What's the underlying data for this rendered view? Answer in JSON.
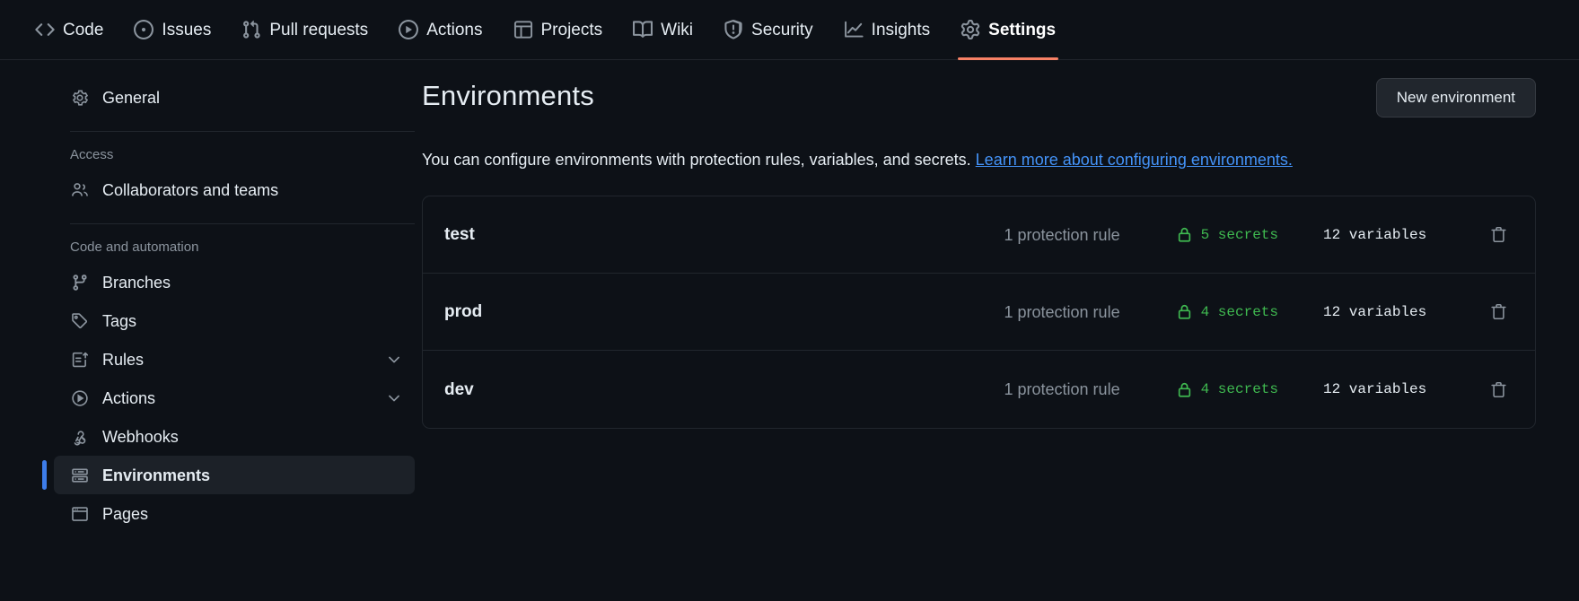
{
  "repo_nav": {
    "items": [
      {
        "label": "Code",
        "icon": "code-icon",
        "active": false
      },
      {
        "label": "Issues",
        "icon": "issue-icon",
        "active": false
      },
      {
        "label": "Pull requests",
        "icon": "git-pull-request-icon",
        "active": false
      },
      {
        "label": "Actions",
        "icon": "play-icon",
        "active": false
      },
      {
        "label": "Projects",
        "icon": "table-icon",
        "active": false
      },
      {
        "label": "Wiki",
        "icon": "book-icon",
        "active": false
      },
      {
        "label": "Security",
        "icon": "shield-icon",
        "active": false
      },
      {
        "label": "Insights",
        "icon": "graph-icon",
        "active": false
      },
      {
        "label": "Settings",
        "icon": "gear-icon",
        "active": true
      }
    ],
    "active_underline_color": "#f78166"
  },
  "sidebar": {
    "groups": [
      {
        "title": null,
        "items": [
          {
            "label": "General",
            "icon": "gear-icon",
            "chevron": false,
            "selected": false
          }
        ]
      },
      {
        "title": "Access",
        "items": [
          {
            "label": "Collaborators and teams",
            "icon": "people-icon",
            "chevron": false,
            "selected": false
          }
        ]
      },
      {
        "title": "Code and automation",
        "items": [
          {
            "label": "Branches",
            "icon": "git-branch-icon",
            "chevron": false,
            "selected": false
          },
          {
            "label": "Tags",
            "icon": "tag-icon",
            "chevron": false,
            "selected": false
          },
          {
            "label": "Rules",
            "icon": "rules-icon",
            "chevron": true,
            "selected": false
          },
          {
            "label": "Actions",
            "icon": "play-icon",
            "chevron": true,
            "selected": false
          },
          {
            "label": "Webhooks",
            "icon": "webhook-icon",
            "chevron": false,
            "selected": false
          },
          {
            "label": "Environments",
            "icon": "server-icon",
            "chevron": false,
            "selected": true
          },
          {
            "label": "Pages",
            "icon": "browser-icon",
            "chevron": false,
            "selected": false
          }
        ]
      }
    ],
    "selected_indicator_color": "#3d7dea"
  },
  "main": {
    "title": "Environments",
    "new_environment_label": "New environment",
    "description_text": "You can configure environments with protection rules, variables, and secrets. ",
    "description_link": "Learn more about configuring environments.",
    "link_color": "#4493f8",
    "environments": [
      {
        "name": "test",
        "protection_rules": "1 protection rule",
        "secrets": "5 secrets",
        "variables": "12 variables",
        "delete_icon": "trash-icon"
      },
      {
        "name": "prod",
        "protection_rules": "1 protection rule",
        "secrets": "4 secrets",
        "variables": "12 variables",
        "delete_icon": "trash-icon"
      },
      {
        "name": "dev",
        "protection_rules": "1 protection rule",
        "secrets": "4 secrets",
        "variables": "12 variables",
        "delete_icon": "trash-icon"
      }
    ],
    "secrets_color": "#3fb950"
  }
}
